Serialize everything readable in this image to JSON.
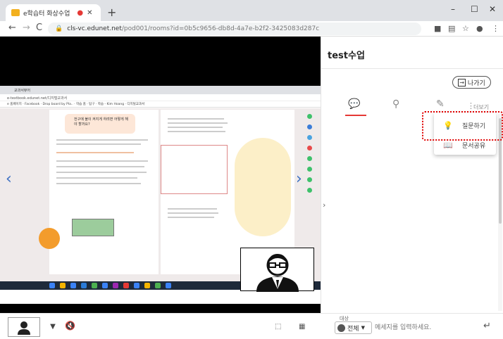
{
  "browser": {
    "tab_title": "e학습터 화상수업",
    "new_tab": "+",
    "url_domain": "cls-vc.edunet.net",
    "url_path": "/pod001/rooms?id=0b5c9656-db8d-4a7e-b2f2-3425083d287c",
    "minimize": "–",
    "maximize": "☐",
    "close": "✕"
  },
  "shared_screen": {
    "inner_tab": "교과서뷰어",
    "inner_url": "e-textbook.edunet.net/디지털교과서",
    "inner_bookmarks": "e 홈페이지  ·  Facebook  ·  Drop board by Pla..  ·  학습 홈  ·  탐구  ·  학습 - Kim Hoang  ·  디지털교과서",
    "page_heading": "전구에 불이 켜지게 하려면 어떻게 해야 할까요?"
  },
  "panel": {
    "room_title": "test수업",
    "leave_label": "나가기",
    "more_label": "더보기",
    "menu": [
      {
        "label": "질문하기",
        "icon": "question-icon"
      },
      {
        "label": "문서공유",
        "icon": "book-icon"
      }
    ]
  },
  "bottom": {
    "target_caption": "대상",
    "target_value": "전체",
    "message_placeholder": "메세지를 입력하세요.",
    "send_icon": "enter-arrow-icon"
  },
  "colors": {
    "accent_red": "#e53935",
    "highlight_border": "#e00000",
    "stage_background": "#000000"
  }
}
